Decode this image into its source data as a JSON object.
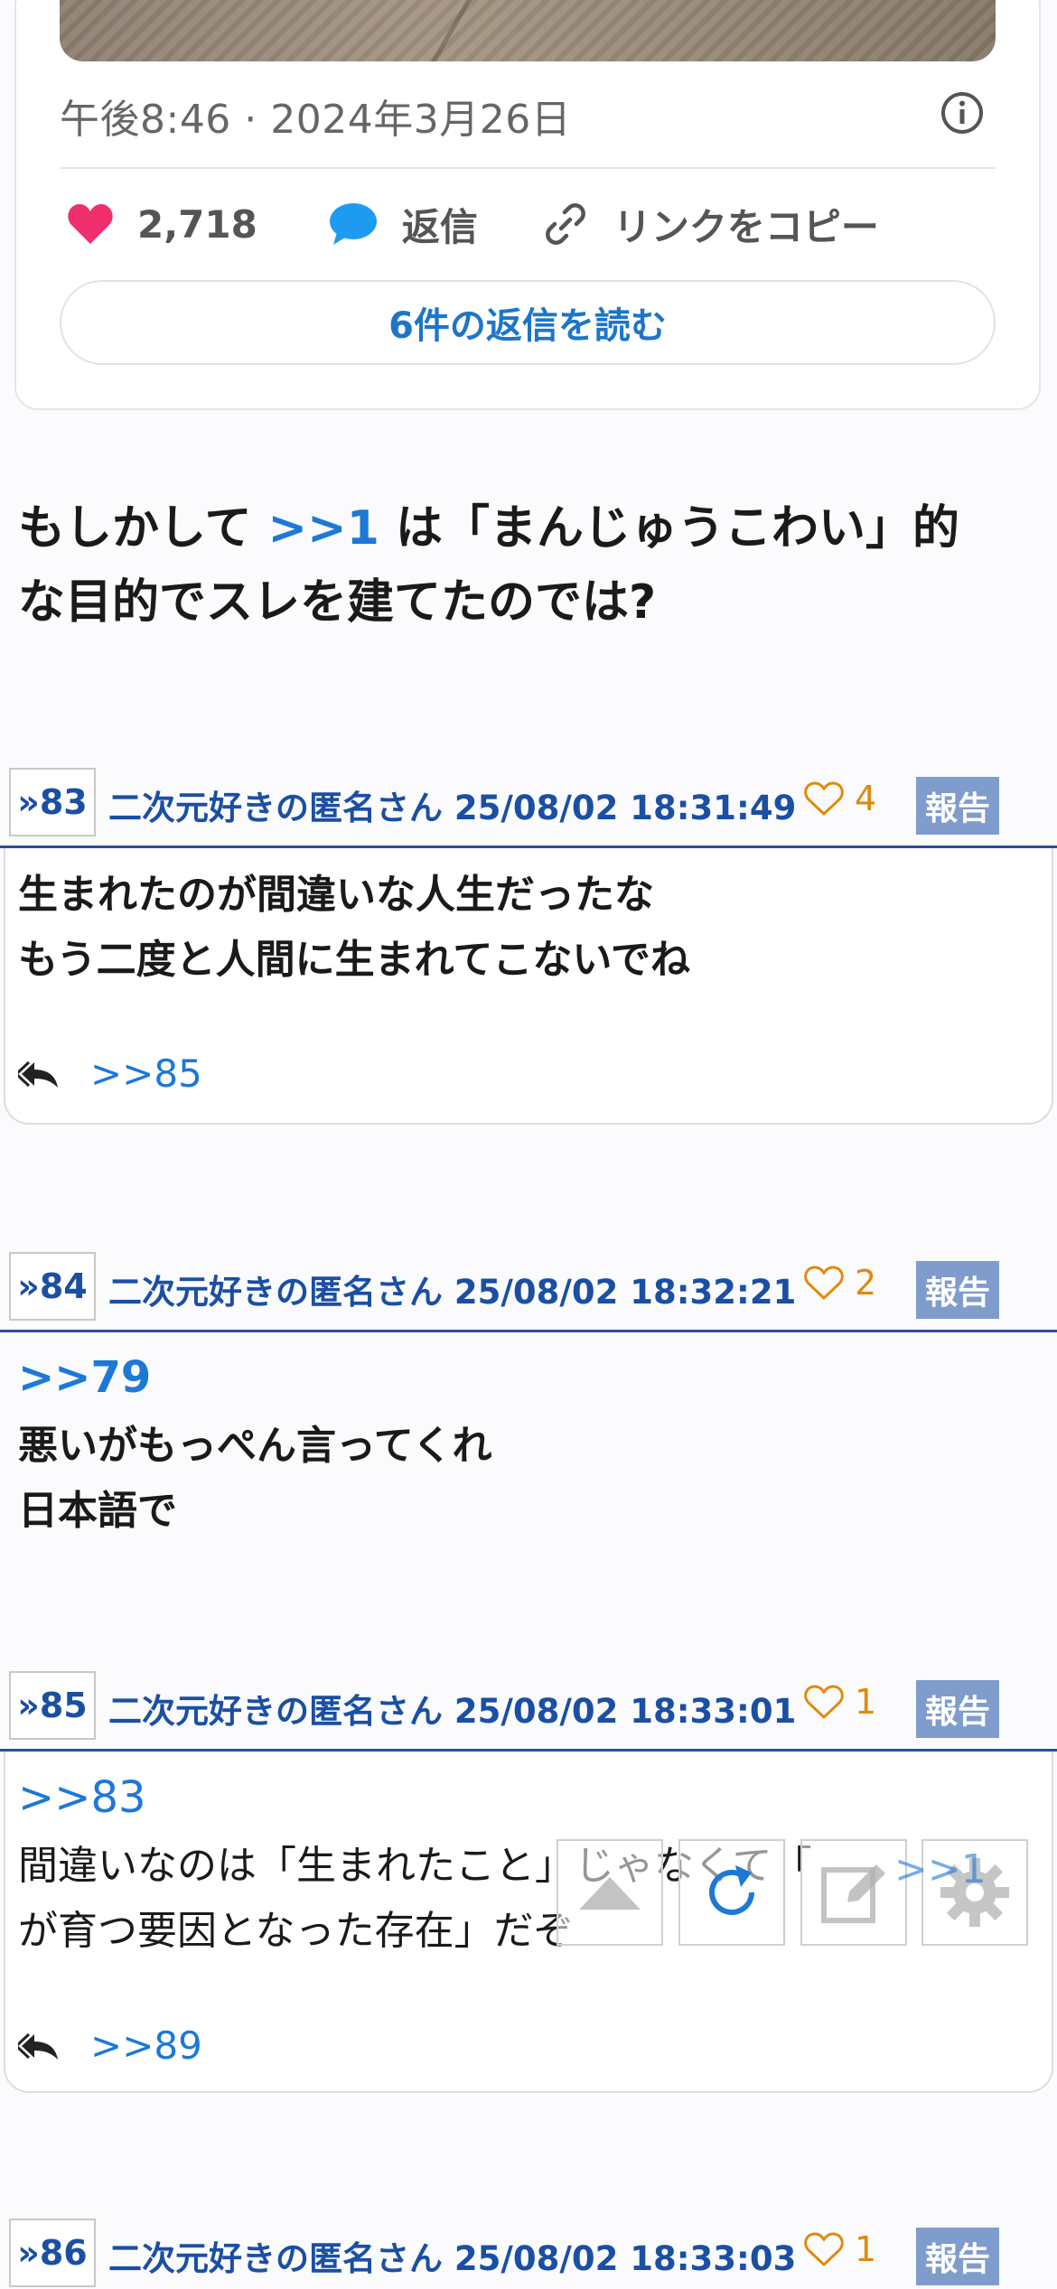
{
  "tweet": {
    "timestamp": "午後8:46 · 2024年3月26日",
    "likes": "2,718",
    "reply_label": "返信",
    "copy_link_label": "リンクをコピー",
    "read_replies_label": "6件の返信を読む"
  },
  "post_text": {
    "prefix": "もしかして ",
    "anchor": ">>1",
    "suffix": " は「まんじゅうこわい」的",
    "line2": "な目的でスレを建てたのでは?"
  },
  "responses": [
    {
      "number": "»83",
      "meta": "二次元好きの匿名さん 25/08/02 18:31:49",
      "likes": "4",
      "report": "報告",
      "lines": [
        "生まれたのが間違いな人生だったな",
        "もう二度と人間に生まれてこないでね"
      ],
      "reply_anchor": ">>85"
    },
    {
      "number": "»84",
      "meta": "二次元好きの匿名さん 25/08/02 18:32:21",
      "likes": "2",
      "report": "報告",
      "anchor": ">>79",
      "lines": [
        "悪いがもっぺん言ってくれ",
        "日本語で"
      ]
    },
    {
      "number": "»85",
      "meta": "二次元好きの匿名さん 25/08/02 18:33:01",
      "likes": "1",
      "report": "報告",
      "anchor": ">>83",
      "lines": [
        "間違いなのは「生まれたこと」じゃなくて「",
        "が育つ要因となった存在」だぞ"
      ],
      "reply_anchor": ">>89"
    },
    {
      "number": "»86",
      "meta": "二次元好きの匿名さん 25/08/02 18:33:03",
      "likes": "1",
      "report": "報告"
    }
  ],
  "toolbar": {
    "overlay_anchor": ">>1"
  },
  "colors": {
    "accent": "#1d78d6",
    "header_text": "#1a4fa3",
    "report_bg": "#7f9ccc",
    "like_color": "#e08a0c",
    "heart": "#f0306e"
  }
}
